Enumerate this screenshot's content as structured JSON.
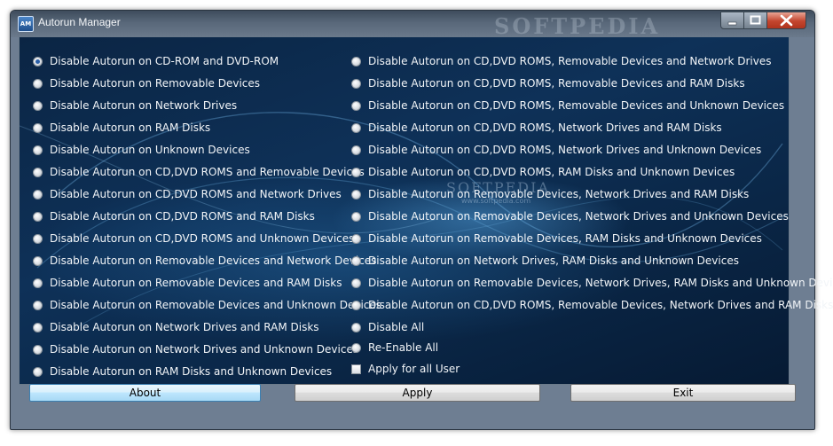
{
  "window": {
    "title": "Autorun Manager",
    "icon": "autorun-app-icon",
    "watermark": "SOFTPEDIA",
    "center_watermark": "SOFTPEDIA",
    "center_watermark_url": "www.softpedia.com"
  },
  "options_left": [
    {
      "label": "Disable Autorun on CD-ROM and DVD-ROM",
      "selected": true
    },
    {
      "label": "Disable Autorun on Removable Devices",
      "selected": false
    },
    {
      "label": "Disable Autorun on Network Drives",
      "selected": false
    },
    {
      "label": "Disable Autorun on RAM Disks",
      "selected": false
    },
    {
      "label": "Disable Autorun on Unknown Devices",
      "selected": false
    },
    {
      "label": "Disable Autorun on CD,DVD ROMS and Removable Devices",
      "selected": false
    },
    {
      "label": "Disable Autorun on CD,DVD ROMS and Network Drives",
      "selected": false
    },
    {
      "label": "Disable Autorun on CD,DVD ROMS and RAM Disks",
      "selected": false
    },
    {
      "label": "Disable Autorun on CD,DVD ROMS and Unknown Devices",
      "selected": false
    },
    {
      "label": "Disable Autorun on Removable Devices and Network Devices",
      "selected": false
    },
    {
      "label": "Disable Autorun on Removable Devices and RAM Disks",
      "selected": false
    },
    {
      "label": "Disable Autorun on Removable Devices and Unknown Devices",
      "selected": false
    },
    {
      "label": "Disable Autorun on Network Drives and RAM Disks",
      "selected": false
    },
    {
      "label": "Disable Autorun on Network Drives and Unknown Devices",
      "selected": false
    },
    {
      "label": "Disable Autorun on RAM Disks and Unknown Devices",
      "selected": false
    }
  ],
  "options_right": [
    {
      "label": "Disable Autorun on CD,DVD ROMS, Removable Devices and Network Drives",
      "selected": false
    },
    {
      "label": "Disable Autorun on CD,DVD ROMS, Removable Devices and RAM Disks",
      "selected": false
    },
    {
      "label": "Disable Autorun on CD,DVD ROMS, Removable Devices and Unknown Devices",
      "selected": false
    },
    {
      "label": "Disable Autorun on CD,DVD ROMS, Network Drives and RAM Disks",
      "selected": false
    },
    {
      "label": "Disable Autorun on CD,DVD ROMS, Network Drives and Unknown Devices",
      "selected": false
    },
    {
      "label": "Disable Autorun on CD,DVD ROMS, RAM Disks and Unknown Devices",
      "selected": false
    },
    {
      "label": "Disable Autorun on Removable Devices, Network Drives and RAM Disks",
      "selected": false
    },
    {
      "label": "Disable Autorun on Removable Devices, Network Drives and Unknown Devices",
      "selected": false
    },
    {
      "label": "Disable Autorun on Removable Devices, RAM Disks and Unknown Devices",
      "selected": false
    },
    {
      "label": "Disable Autorun on Network Drives, RAM Disks and Unknown Devices",
      "selected": false
    },
    {
      "label": "Disable Autorun on Removable Devices, Network Drives, RAM Disks and Unknown Devices",
      "selected": false
    },
    {
      "label": "Disable Autorun on CD,DVD ROMS, Removable Devices, Network Drives and RAM Disks",
      "selected": false
    },
    {
      "label": "Disable All",
      "selected": false
    },
    {
      "label": "Re-Enable All",
      "selected": false
    }
  ],
  "apply_all_checkbox": {
    "label": "Apply for all User",
    "checked": false
  },
  "buttons": {
    "about": "About",
    "apply": "Apply",
    "exit": "Exit"
  },
  "colors": {
    "panel_bg": "#0e3158",
    "label_text": "#f2f5f8",
    "close_button": "#c3452e"
  }
}
